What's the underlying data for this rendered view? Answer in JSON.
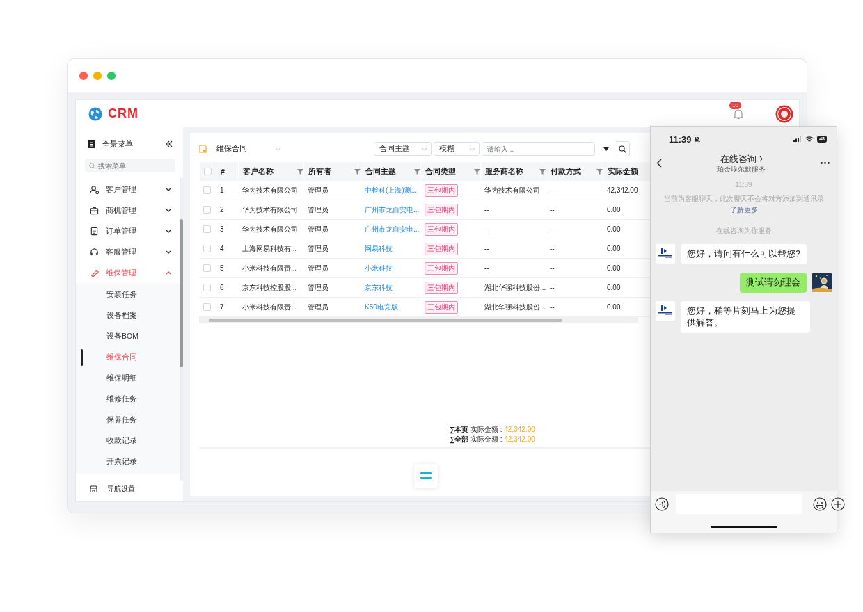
{
  "window": {
    "traffic_lights": [
      {
        "color": "#fe5f57"
      },
      {
        "color": "#f5b400"
      },
      {
        "color": "#2bc666"
      }
    ]
  },
  "header": {
    "logo_text": "CRM",
    "notification_count": "10"
  },
  "sidebar": {
    "menu_title": "全景菜单",
    "search": {
      "placeholder": "搜索菜单"
    },
    "items": [
      {
        "label": "客户管理",
        "expanded": false
      },
      {
        "label": "商机管理",
        "expanded": false
      },
      {
        "label": "订单管理",
        "expanded": false
      },
      {
        "label": "客服管理",
        "expanded": false
      },
      {
        "label": "维保管理",
        "expanded": true,
        "children": [
          {
            "label": "安装任务",
            "selected": false
          },
          {
            "label": "设备档案",
            "selected": false
          },
          {
            "label": "设备BOM",
            "selected": false
          },
          {
            "label": "维保合同",
            "selected": true
          },
          {
            "label": "维保明细",
            "selected": false
          },
          {
            "label": "维修任务",
            "selected": false
          },
          {
            "label": "保养任务",
            "selected": false
          },
          {
            "label": "收款记录",
            "selected": false
          },
          {
            "label": "开票记录",
            "selected": false
          }
        ]
      }
    ],
    "footer": "导航设置"
  },
  "toolbar": {
    "view": "维保合同",
    "field_select": "合同主题",
    "mode_select": "模糊",
    "search": {
      "placeholder": "请输入..."
    }
  },
  "table": {
    "header_checked": false,
    "columns": [
      "#",
      "客户名称",
      "所有者",
      "合同主题",
      "合同类型",
      "服务商名称",
      "付款方式",
      "实际金额"
    ],
    "rows": [
      {
        "checked": false,
        "cells": [
          "1",
          "华为技术有限公司",
          "管理员",
          "中检科(上海)测...",
          "三包期内",
          "华为技术有限公司",
          "--",
          "42,342.00"
        ]
      },
      {
        "checked": false,
        "cells": [
          "2",
          "华为技术有限公司",
          "管理员",
          "广州市龙自安电...",
          "三包期内",
          "--",
          "--",
          "0.00"
        ]
      },
      {
        "checked": false,
        "cells": [
          "3",
          "华为技术有限公司",
          "管理员",
          "广州市龙自安电...",
          "三包期内",
          "--",
          "--",
          "0.00"
        ]
      },
      {
        "checked": false,
        "cells": [
          "4",
          "上海网易科技有...",
          "管理员",
          "网易科技",
          "三包期内",
          "--",
          "--",
          "0.00"
        ]
      },
      {
        "checked": false,
        "cells": [
          "5",
          "小米科技有限责...",
          "管理员",
          "小米科技",
          "三包期内",
          "--",
          "--",
          "0.00"
        ]
      },
      {
        "checked": false,
        "cells": [
          "6",
          "京东科技控股股...",
          "管理员",
          "京东科技",
          "三包期内",
          "湖北华强科技股份...",
          "--",
          "0.00"
        ]
      },
      {
        "checked": false,
        "cells": [
          "7",
          "小米科技有限责...",
          "管理员",
          "K50电竞版",
          "三包期内",
          "湖北华强科技股份...",
          "--",
          "0.00"
        ]
      }
    ]
  },
  "summary": [
    {
      "label": "∑本页",
      "field": "实际金额 :",
      "value": "42,342.00"
    },
    {
      "label": "∑全部",
      "field": "实际金额 :",
      "value": "42,342.00"
    }
  ],
  "phone": {
    "status_time": "11:39",
    "battery": "48",
    "title": "在线咨询",
    "subtitle": "珀金埃尔默服务",
    "time": "11:39",
    "notice": "当前为客服聊天，此次聊天不会将对方添加到通讯录",
    "notice_link": "了解更多",
    "service_note": "在线咨询为你服务",
    "messages": [
      {
        "kind": "received",
        "text": "您好，请问有什么可以帮您?"
      },
      {
        "kind": "sent",
        "text": "测试请勿理会"
      },
      {
        "kind": "received",
        "text": "您好，稍等片刻马上为您提供解答。"
      }
    ]
  }
}
